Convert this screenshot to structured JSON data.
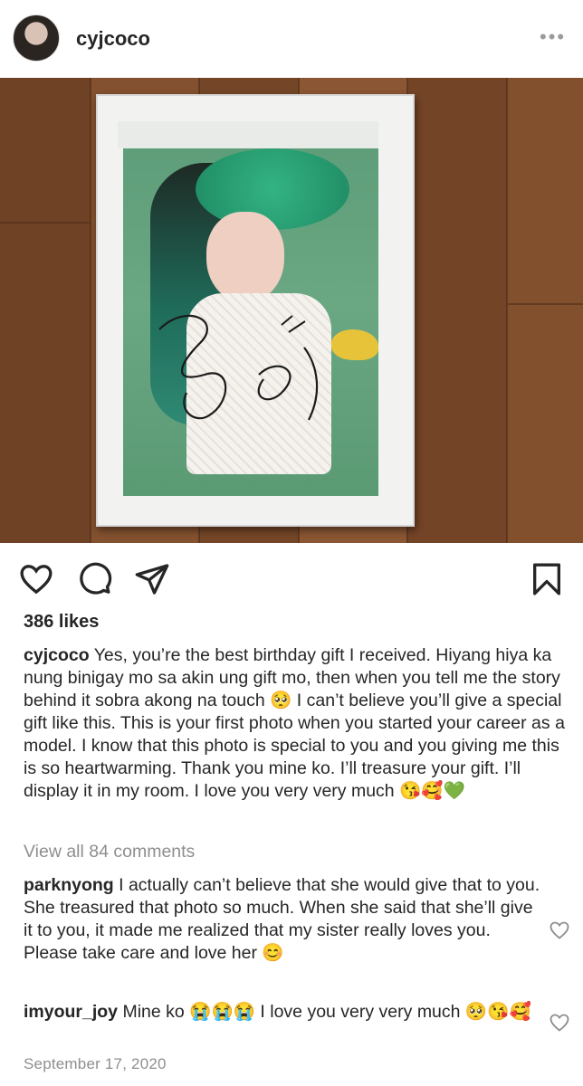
{
  "post": {
    "username": "cyjcoco",
    "more_icon": "more-horizontal-icon",
    "signature_text": "Joy"
  },
  "actions": {
    "like_icon": "heart-icon",
    "comment_icon": "comment-icon",
    "share_icon": "send-icon",
    "save_icon": "bookmark-icon"
  },
  "likes_text": "386 likes",
  "caption": {
    "username": "cyjcoco",
    "text": "Yes, you’re the best birthday gift I received. Hiyang hiya ka nung binigay mo sa akin ung gift mo, then when you tell me the story behind it sobra akong na touch 🥺 I can’t believe you’ll give a special gift like this. This is your first photo when you started your career as a model. I know that this photo is special to you and you giving me this is so heartwarming. Thank you mine ko. I’ll treasure your gift. I’ll display it in my room. I love you very very much 😘🥰💚"
  },
  "view_all_comments": "View all 84 comments",
  "comments": [
    {
      "username": "parknyong",
      "text": "I actually can’t believe that she would give that to you. She treasured that photo so much. When she said that she’ll give it to you, it made me realized that my sister really loves you. Please take care and love her 😊"
    },
    {
      "username": "imyour_joy",
      "text": "Mine ko 😭😭😭 I love you very very much 🥺😘🥰"
    }
  ],
  "date": "September 17, 2020"
}
